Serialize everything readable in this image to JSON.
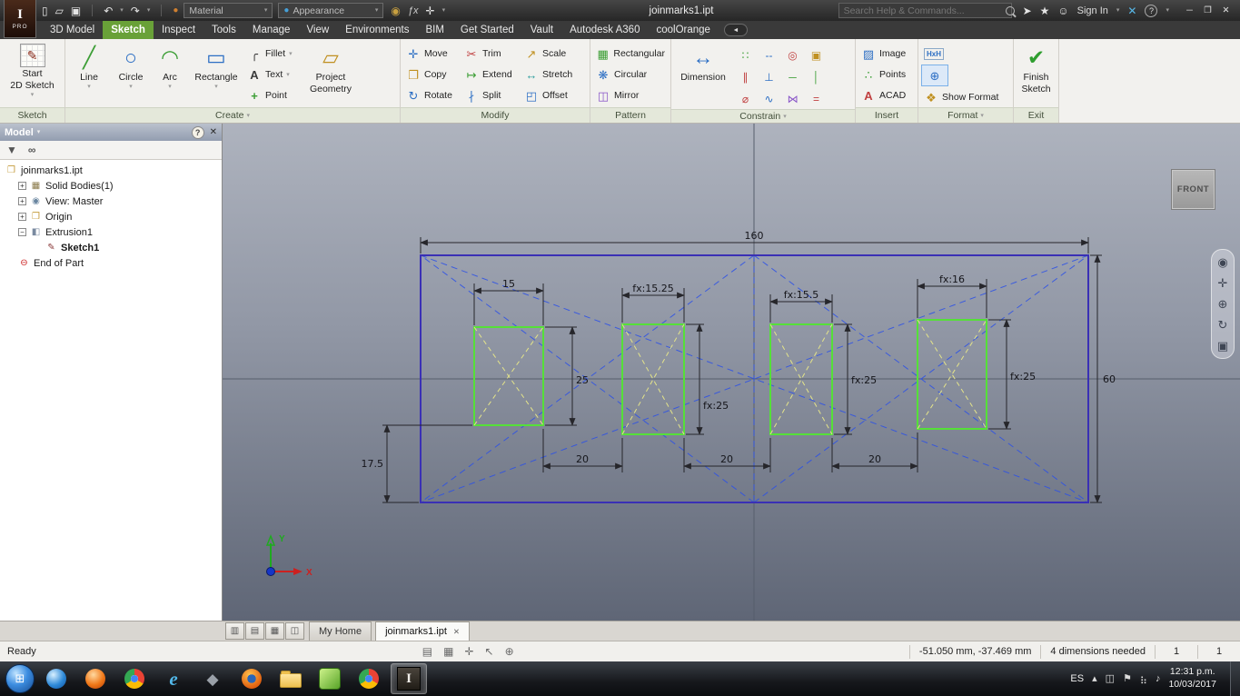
{
  "colors": {
    "tab_active_green": "#69a138",
    "finish_check_green": "#2f9e2f",
    "sketch_outline_purple": "#3a30b5",
    "profile_green": "#55e038",
    "construction_blue": "#2b50e8",
    "construction_yellow": "#e4e48a",
    "canvas_top": "#aeb3be",
    "canvas_bottom": "#5f6676"
  },
  "ui": {
    "chev": "▾",
    "plus": "+",
    "minus": "−"
  },
  "titlebar": {
    "badge": "PRO",
    "logo_mark": "I",
    "qa": [
      {
        "n": "new-file-icon",
        "g": "▯"
      },
      {
        "n": "open-file-icon",
        "g": "▱"
      },
      {
        "n": "save-icon",
        "g": "▣"
      }
    ],
    "undo_g": "↶",
    "redo_g": "↷",
    "material_ball": "●",
    "material_label": "Material",
    "appearance_ball": "●",
    "appearance_label": "Appearance",
    "extras": [
      {
        "n": "paint-icon",
        "g": "◉"
      },
      {
        "n": "fx-icon",
        "g": "ƒx"
      },
      {
        "n": "move-widget-icon",
        "g": "✛"
      }
    ],
    "doc_title": "joinmarks1.ipt",
    "search_placeholder": "Search Help & Commands...",
    "share_g": "➤",
    "star_g": "★",
    "person_g": "☺",
    "sign_in": "Sign In",
    "x_app_g": "✕",
    "help_g": "?",
    "win_min": "─",
    "win_restore": "❐",
    "win_close": "✕"
  },
  "tabs": [
    "3D Model",
    "Sketch",
    "Inspect",
    "Tools",
    "Manage",
    "View",
    "Environments",
    "BIM",
    "Get Started",
    "Vault",
    "Autodesk A360",
    "coolOrange"
  ],
  "ribbon": {
    "sketch": {
      "label": "Sketch",
      "l1": "Start",
      "l2": "2D Sketch",
      "icon_g": "✎"
    },
    "create": {
      "label": "Create",
      "line": "Line",
      "line_g": "╱",
      "circle": "Circle",
      "circle_g": "○",
      "arc": "Arc",
      "arc_g": "◠",
      "rect": "Rectangle",
      "rect_g": "▭",
      "fillet": "Fillet",
      "fillet_g": "╭",
      "text": "Text",
      "text_g": "A",
      "point": "Point",
      "point_g": "+",
      "pg1": "Project",
      "pg2": "Geometry",
      "pg_g": "▱"
    },
    "modify": {
      "label": "Modify",
      "items": [
        {
          "l": "Move",
          "g": "✛"
        },
        {
          "l": "Copy",
          "g": "❐"
        },
        {
          "l": "Rotate",
          "g": "↻"
        },
        {
          "l": "Trim",
          "g": "✂"
        },
        {
          "l": "Extend",
          "g": "↦"
        },
        {
          "l": "Split",
          "g": "∤"
        },
        {
          "l": "Scale",
          "g": "↗"
        },
        {
          "l": "Stretch",
          "g": "↔"
        },
        {
          "l": "Offset",
          "g": "◰"
        }
      ]
    },
    "pattern": {
      "label": "Pattern",
      "items": [
        {
          "l": "Rectangular",
          "g": "▦"
        },
        {
          "l": "Circular",
          "g": "❋"
        },
        {
          "l": "Mirror",
          "g": "◫"
        }
      ]
    },
    "constrain": {
      "label": "Constrain",
      "dim_label": "Dimension",
      "dim_g": "↔",
      "items": [
        {
          "n": "coincident-constraint-icon",
          "g": "∷"
        },
        {
          "n": "collinear-constraint-icon",
          "g": "--"
        },
        {
          "n": "concentric-constraint-icon",
          "g": "◎"
        },
        {
          "n": "fix-constraint-icon",
          "g": "▣"
        },
        {
          "n": "parallel-constraint-icon",
          "g": "∥"
        },
        {
          "n": "perpendicular-constraint-icon",
          "g": "⊥"
        },
        {
          "n": "horizontal-constraint-icon",
          "g": "─"
        },
        {
          "n": "vertical-constraint-icon",
          "g": "│"
        },
        {
          "n": "tangent-constraint-icon",
          "g": "⌀"
        },
        {
          "n": "smooth-constraint-icon",
          "g": "∿"
        },
        {
          "n": "symmetric-constraint-icon",
          "g": "⋈"
        },
        {
          "n": "equal-constraint-icon",
          "g": "="
        }
      ]
    },
    "insert": {
      "label": "Insert",
      "items": [
        {
          "l": "Image",
          "g": "▨"
        },
        {
          "l": "Points",
          "g": "∴"
        },
        {
          "l": "ACAD",
          "g": "A"
        }
      ]
    },
    "format": {
      "label": "Format",
      "icon1_g": "HxH",
      "icon2_g": "⊕",
      "show_format": "Show Format",
      "sf_g": "❖"
    },
    "exit": {
      "label": "Exit",
      "l1": "Finish",
      "l2": "Sketch",
      "g": "✔"
    }
  },
  "browser": {
    "title": "Model",
    "help_g": "?",
    "close_g": "✕",
    "filter_g": "▼",
    "search_g": "∞",
    "tree": [
      {
        "label": "joinmarks1.ipt",
        "icon_g": "❒"
      },
      {
        "label": "Solid Bodies(1)",
        "icon_g": "▦"
      },
      {
        "label": "View: Master",
        "icon_g": "◉"
      },
      {
        "label": "Origin",
        "icon_g": "❒"
      },
      {
        "label": "Extrusion1",
        "icon_g": "◧"
      },
      {
        "label": "Sketch1",
        "icon_g": "✎"
      },
      {
        "label": "End of Part",
        "icon_g": "⊖"
      }
    ]
  },
  "sketch": {
    "viewcube": "FRONT",
    "axis_x": "X",
    "axis_y": "Y",
    "dims": {
      "total_w": "160",
      "total_h": "60",
      "r1w": "15",
      "r2w": "fx:15.25",
      "r3w": "fx:15.5",
      "r4w": "fx:16",
      "r1h": "25",
      "r2h": "fx:25",
      "r3h": "fx:25",
      "r4h": "fx:25",
      "g1": "20",
      "g2": "20",
      "g3": "20",
      "off": "17.5"
    }
  },
  "doctabs": {
    "layout": [
      "▥",
      "▤",
      "▦",
      "◫"
    ],
    "home_tab": "My Home",
    "doc_tab": "joinmarks1.ipt",
    "close_g": "✕"
  },
  "status": {
    "ready": "Ready",
    "icons": [
      {
        "n": "edit-dimension-icon",
        "g": "▤"
      },
      {
        "n": "grid-icon",
        "g": "▦"
      },
      {
        "n": "precise-input-icon",
        "g": "✛"
      },
      {
        "n": "select-icon",
        "g": "↖"
      },
      {
        "n": "snap-icon",
        "g": "⊕"
      }
    ],
    "coords": "-51.050 mm, -37.469 mm",
    "needed": "4 dimensions needed",
    "n1": "1",
    "n2": "1"
  },
  "taskbar": {
    "ie_g": "e",
    "inkscape_g": "◆",
    "inventor_g": "I",
    "orb_g": "⊞",
    "lang": "ES",
    "up_g": "▴",
    "tray_icons": [
      {
        "n": "keyboard-tray-icon",
        "g": "◫"
      },
      {
        "n": "flag-tray-icon",
        "g": "⚑"
      },
      {
        "n": "network-tray-icon",
        "g": "⣦"
      },
      {
        "n": "volume-tray-icon",
        "g": "♪"
      }
    ],
    "time": "12:31 p.m.",
    "date": "10/03/2017"
  }
}
